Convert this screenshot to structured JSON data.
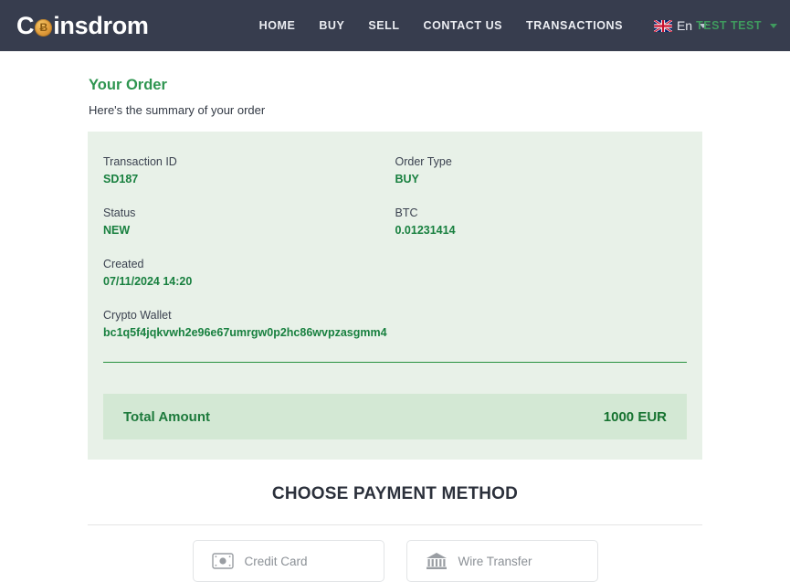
{
  "header": {
    "logo_text_1": "C",
    "logo_coin_glyph": "Ɓ",
    "logo_text_2": "insdrom",
    "logo_icon": "coin-icon",
    "nav": [
      {
        "label": "HOME",
        "name": "nav-home"
      },
      {
        "label": "BUY",
        "name": "nav-buy"
      },
      {
        "label": "SELL",
        "name": "nav-sell"
      },
      {
        "label": "CONTACT US",
        "name": "nav-contact-us"
      },
      {
        "label": "TRANSACTIONS",
        "name": "nav-transactions"
      }
    ],
    "language": {
      "label": "En",
      "flag_icon": "uk-flag-icon",
      "chevron_icon": "chevron-down-icon"
    },
    "user": {
      "name": "TEST TEST",
      "chevron_icon": "chevron-down-icon"
    },
    "colors": {
      "background": "#373d4e",
      "nav_text": "#eceef3",
      "user_text": "#3f9a5e"
    }
  },
  "order": {
    "title": "Your Order",
    "subtitle": "Here's the summary of your order",
    "fields": [
      {
        "label": "Transaction ID",
        "value": "SD187"
      },
      {
        "label": "Order Type",
        "value": "BUY"
      },
      {
        "label": "Status",
        "value": "NEW"
      },
      {
        "label": "BTC",
        "value": "0.01231414"
      },
      {
        "label": "Created",
        "value": "07/11/2024 14:20"
      },
      {
        "label": "Crypto Wallet",
        "value": "bc1q5f4jqkvwh2e96e67umrgw0p2hc86wvpzasgmm4"
      }
    ],
    "total": {
      "label": "Total Amount",
      "value": "1000 EUR"
    },
    "colors": {
      "card_background": "#e8f1e8",
      "total_background": "#d3e8d4",
      "value_text": "#18803f",
      "accent": "#2e9550"
    }
  },
  "payment": {
    "heading": "CHOOSE PAYMENT METHOD",
    "methods": [
      {
        "label": "Credit Card",
        "icon": "credit-card-icon",
        "name": "payment-method-credit-card"
      },
      {
        "label": "Wire Transfer",
        "icon": "bank-icon",
        "name": "payment-method-wire-transfer"
      }
    ]
  }
}
